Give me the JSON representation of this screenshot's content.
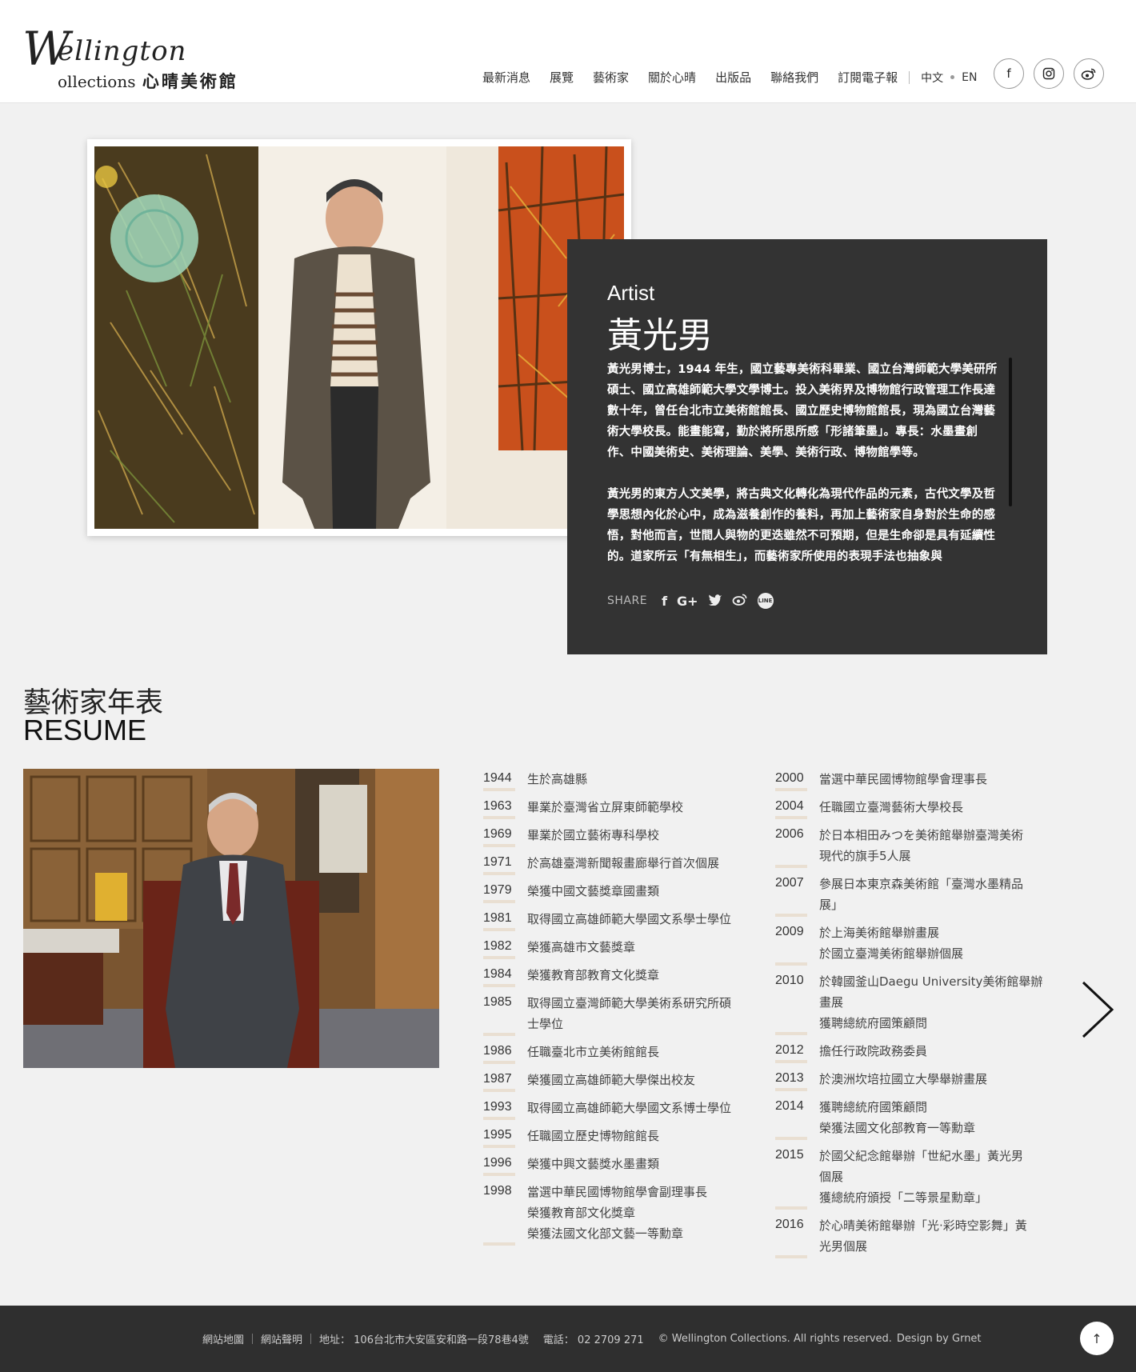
{
  "brand": {
    "logo_letter": "W",
    "logo_top": "ellington",
    "logo_bottom": "ollections",
    "logo_zh": "心晴美術館"
  },
  "nav": {
    "items": [
      "最新消息",
      "展覽",
      "藝術家",
      "關於心晴",
      "出版品",
      "聯絡我們",
      "訂閱電子報"
    ],
    "lang_zh": "中文",
    "lang_en": "EN"
  },
  "social_top": {
    "facebook": "f",
    "instagram": "◎",
    "weibo": "微"
  },
  "artist": {
    "label": "Artist",
    "name": "黃光男",
    "bio": [
      "黃光男博士，1944 年生，國立藝專美術科畢業、國立台灣師範大學美研所碩士、國立高雄師範大學文學博士。投入美術界及博物館行政管理工作長達數十年，曾任台北市立美術館館長、國立歷史博物館館長，現為國立台灣藝術大學校長。能畫能寫，勤於將所思所感「形諸筆墨」。專長：水墨畫創作、中國美術史、美術理論、美學、美術行政、博物館學等。",
      "黃光男的東方人文美學，將古典文化轉化為現代作品的元素，古代文學及哲學思想內化於心中，成為滋養創作的養料，再加上藝術家自身對於生命的感悟，對他而言，世間人與物的更迭雖然不可預期，但是生命卻是具有延續性的。道家所云「有無相生」，而藝術家所使用的表現手法也抽象與"
    ],
    "share_label": "SHARE",
    "share_icons": [
      "f",
      "G+",
      "t",
      "微",
      "LINE"
    ]
  },
  "resume": {
    "title_zh": "藝術家年表",
    "title_en": "RESUME",
    "col1": [
      {
        "year": "1944",
        "lines": [
          "生於高雄縣"
        ]
      },
      {
        "year": "1963",
        "lines": [
          "畢業於臺灣省立屏東師範學校"
        ]
      },
      {
        "year": "1969",
        "lines": [
          "畢業於國立藝術專科學校"
        ]
      },
      {
        "year": "1971",
        "lines": [
          "於高雄臺灣新聞報畫廊舉行首次個展"
        ]
      },
      {
        "year": "1979",
        "lines": [
          "榮獲中國文藝獎章國畫類"
        ]
      },
      {
        "year": "1981",
        "lines": [
          "取得國立高雄師範大學國文系學士學位"
        ]
      },
      {
        "year": "1982",
        "lines": [
          "榮獲高雄市文藝獎章"
        ]
      },
      {
        "year": "1984",
        "lines": [
          "榮獲教育部教育文化獎章"
        ]
      },
      {
        "year": "1985",
        "lines": [
          "取得國立臺灣師範大學美術系研究所碩",
          "士學位"
        ]
      },
      {
        "year": "1986",
        "lines": [
          "任職臺北市立美術館館長"
        ]
      },
      {
        "year": "1987",
        "lines": [
          "榮獲國立高雄師範大學傑出校友"
        ]
      },
      {
        "year": "1993",
        "lines": [
          "取得國立高雄師範大學國文系博士學位"
        ]
      },
      {
        "year": "1995",
        "lines": [
          "任職國立歷史博物館館長"
        ]
      },
      {
        "year": "1996",
        "lines": [
          "榮獲中興文藝獎水墨畫類"
        ]
      },
      {
        "year": "1998",
        "lines": [
          "當選中華民國博物館學會副理事長",
          "榮獲教育部文化獎章",
          "榮獲法國文化部文藝一等勳章"
        ]
      }
    ],
    "col2": [
      {
        "year": "2000",
        "lines": [
          "當選中華民國博物館學會理事長"
        ]
      },
      {
        "year": "2004",
        "lines": [
          "任職國立臺灣藝術大學校長"
        ]
      },
      {
        "year": "2006",
        "lines": [
          "於日本相田みつを美術館舉辦臺灣美術",
          "現代的旗手5人展"
        ]
      },
      {
        "year": "2007",
        "lines": [
          "參展日本東京森美術館「臺灣水墨精品",
          "展」"
        ]
      },
      {
        "year": "2009",
        "lines": [
          "於上海美術館舉辦畫展",
          "於國立臺灣美術館舉辦個展"
        ]
      },
      {
        "year": "2010",
        "lines": [
          "於韓國釜山Daegu University美術館舉辦",
          "畫展",
          "獲聘總統府國策顧問"
        ]
      },
      {
        "year": "2012",
        "lines": [
          "擔任行政院政務委員"
        ]
      },
      {
        "year": "2013",
        "lines": [
          "於澳洲坎培拉國立大學舉辦畫展"
        ]
      },
      {
        "year": "2014",
        "lines": [
          "獲聘總統府國策顧問",
          "榮獲法國文化部教育一等勳章"
        ]
      },
      {
        "year": "2015",
        "lines": [
          "於國父紀念館舉辦「世紀水墨」黃光男",
          "個展",
          "獲總統府頒授「二等景星勳章」"
        ]
      },
      {
        "year": "2016",
        "lines": [
          "於心晴美術館舉辦「光‧彩時空影舞」黃",
          "光男個展"
        ]
      }
    ]
  },
  "footer": {
    "sitemap": "網站地圖",
    "disclaimer": "網站聲明",
    "address": "地址： 106台北市大安區安和路一段78巷4號",
    "phone": "電話： 02 2709 271",
    "copyright": "© Wellington Collections.  All rights reserved.",
    "design": "Design by Grnet",
    "top_button": "↑"
  },
  "colors": {
    "card_bg": "#333333",
    "footer_bg": "#2f2f2f",
    "page_bg": "#f1f1f1",
    "year_underline": "#e9dfd2"
  }
}
